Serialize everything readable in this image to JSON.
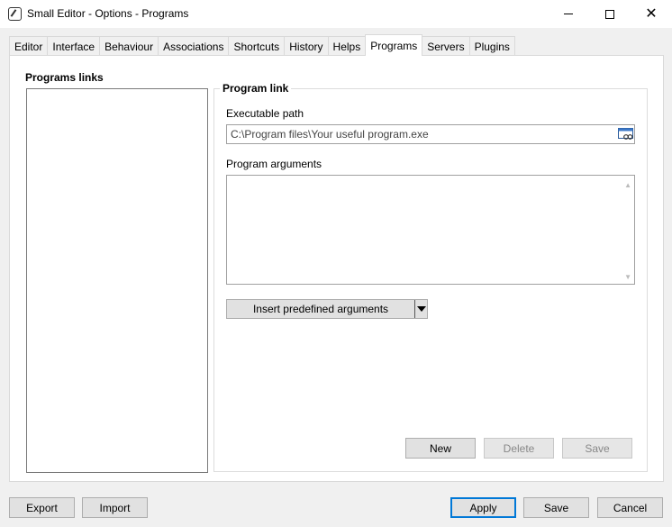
{
  "window": {
    "title": "Small Editor - Options - Programs"
  },
  "tabs": [
    {
      "label": "Editor"
    },
    {
      "label": "Interface"
    },
    {
      "label": "Behaviour"
    },
    {
      "label": "Associations"
    },
    {
      "label": "Shortcuts"
    },
    {
      "label": "History"
    },
    {
      "label": "Helps"
    },
    {
      "label": "Programs",
      "active": true
    },
    {
      "label": "Servers"
    },
    {
      "label": "Plugins"
    }
  ],
  "left": {
    "title": "Programs links"
  },
  "program_link": {
    "title": "Program link",
    "exe_label": "Executable path",
    "exe_value": "C:\\Program files\\Your useful program.exe",
    "args_label": "Program arguments",
    "args_value": "",
    "insert_label": "Insert predefined arguments",
    "new_label": "New",
    "delete_label": "Delete",
    "save_label": "Save"
  },
  "footer": {
    "export_label": "Export",
    "import_label": "Import",
    "apply_label": "Apply",
    "save_label": "Save",
    "cancel_label": "Cancel"
  },
  "colors": {
    "accent": "#0078d7",
    "panel_bg": "#ffffff",
    "window_bg": "#f0f0f0"
  }
}
